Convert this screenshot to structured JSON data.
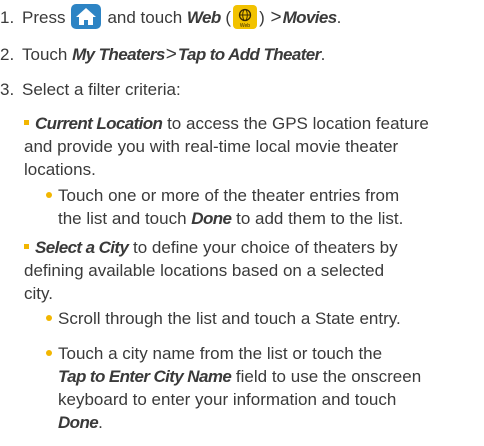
{
  "steps": {
    "s1": {
      "num": "1.",
      "pre": "Press",
      "mid": "and touch",
      "web": "Web",
      "open": "(",
      "close": ")",
      "gt": ">",
      "movies": "Movies",
      "period": "."
    },
    "s2": {
      "num": "2.",
      "pre": "Touch",
      "a": "My Theaters",
      "gt": ">",
      "b": "Tap to Add Theater",
      "period": "."
    },
    "s3": {
      "num": "3.",
      "text": "Select a filter criteria:"
    }
  },
  "current_location": {
    "bold": "Current Location",
    "l1": " to access the GPS location feature",
    "l2": "and provide you with real-time local movie theater",
    "l3": "locations.",
    "sub": {
      "l1": "Touch one or more of the theater entries from",
      "l2a": "the list and touch ",
      "done": "Done",
      "l2b": " to add them to the list."
    }
  },
  "select_city": {
    "bold": "Select a City",
    "l1": " to define your choice of theaters by",
    "l2": "defining available locations based on a selected",
    "l3": "city.",
    "sub1": "Scroll through the list and touch a State entry.",
    "sub2": {
      "l1": "Touch a city name from the list or touch the",
      "bold": "Tap to Enter City Name",
      "l2": " field to use the onscreen",
      "l3": "keyboard to enter your information and touch",
      "done": "Done",
      "period": "."
    }
  },
  "icons": {
    "home": "home-icon",
    "web": "globe-icon",
    "web_caption": "Web"
  },
  "colors": {
    "bullet": "#f2b600",
    "home_icon_bg": "#2d84c4",
    "web_icon_bg": "#f2c200",
    "text": "#3a3a3a"
  }
}
